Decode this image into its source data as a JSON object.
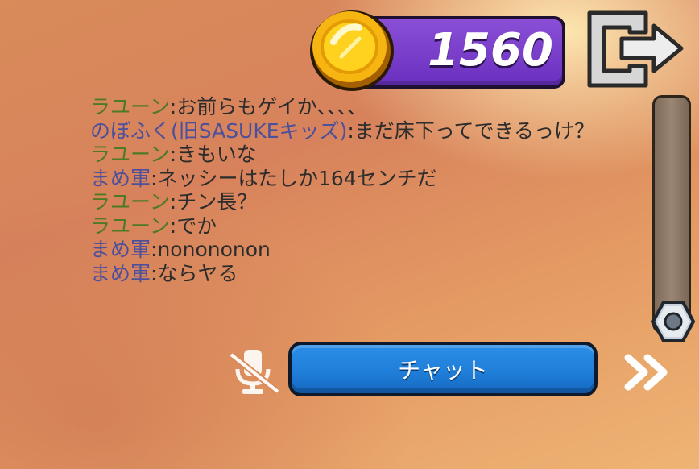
{
  "currency": {
    "coins": "1560"
  },
  "chat": {
    "messages": [
      {
        "name": "ラユーン",
        "text": "お前らもゲイか、、、、",
        "name_color": "#4f7a24"
      },
      {
        "name": "のぼふく(旧SASUKEキッズ)",
        "text": "まだ床下ってできるっけ？",
        "name_color": "#4b4f9c"
      },
      {
        "name": "ラユーン",
        "text": "きもいな",
        "name_color": "#4f7a24"
      },
      {
        "name": "まめ軍",
        "text": "ネッシーはたしか164センチだ",
        "name_color": "#4b4f9c"
      },
      {
        "name": "ラユーン",
        "text": "チン長？",
        "name_color": "#4f7a24"
      },
      {
        "name": "ラユーン",
        "text": "でか",
        "name_color": "#4f7a24"
      },
      {
        "name": "まめ軍",
        "text": "nonononon",
        "name_color": "#4b4f9c"
      },
      {
        "name": "まめ軍",
        "text": "ならヤる",
        "name_color": "#4b4f9c"
      }
    ],
    "separator": ":"
  },
  "buttons": {
    "chat_label": "チャット"
  },
  "icons": {
    "coin": "coin-icon",
    "exit": "exit-door-icon",
    "mute": "muted-microphone-icon",
    "next": "double-chevron-right-icon",
    "scroll_handle": "hex-nut-icon"
  },
  "colors": {
    "coin_panel": "#6a2fbf",
    "chat_button": "#1f7fd9",
    "text": "#2c2c2c"
  }
}
